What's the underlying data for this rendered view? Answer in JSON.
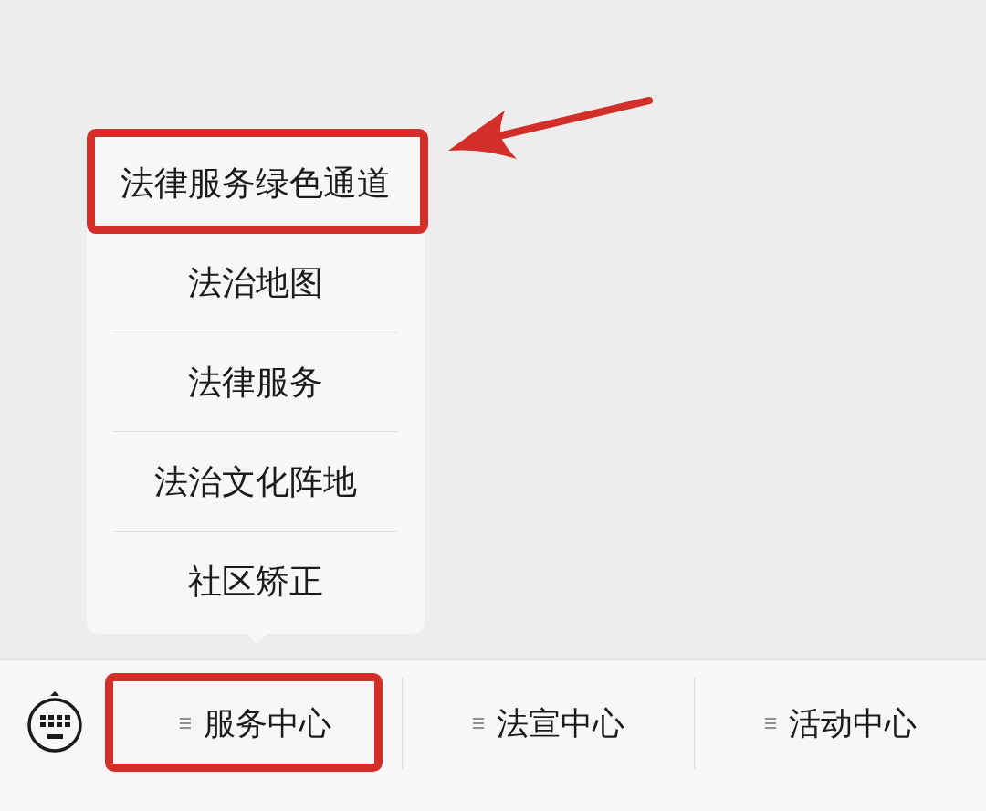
{
  "menu_bar": {
    "buttons": [
      {
        "label": "服务中心",
        "highlighted": true,
        "submenu": [
          {
            "label": "法律服务绿色通道",
            "highlighted": true,
            "arrow": true
          },
          {
            "label": "法治地图",
            "highlighted": false,
            "arrow": false
          },
          {
            "label": "法律服务",
            "highlighted": false,
            "arrow": false
          },
          {
            "label": "法治文化阵地",
            "highlighted": false,
            "arrow": false
          },
          {
            "label": "社区矫正",
            "highlighted": false,
            "arrow": false
          }
        ]
      },
      {
        "label": "法宣中心",
        "highlighted": false
      },
      {
        "label": "活动中心",
        "highlighted": false
      }
    ]
  }
}
